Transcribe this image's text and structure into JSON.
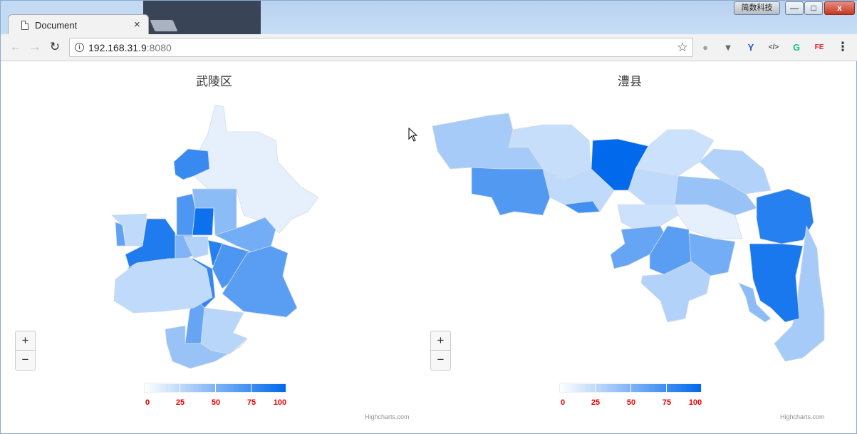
{
  "browser": {
    "tab_title": "Document",
    "tab_close": "×",
    "window_label": "简数科技",
    "win_min": "—",
    "win_max": "□",
    "win_close": "x",
    "url_host": "192.168.31.9",
    "url_port": ":8080",
    "info_icon": "i",
    "star_icon": "☆",
    "back_icon": "←",
    "forward_icon": "→",
    "reload_icon": "↻",
    "extensions": [
      {
        "name": "circle-ext-icon",
        "glyph": "●",
        "color": "#9aa39a"
      },
      {
        "name": "vue-ext-icon",
        "glyph": "▼",
        "color": "#666"
      },
      {
        "name": "y-ext-icon",
        "glyph": "Y",
        "color": "#2a55c8"
      },
      {
        "name": "code-ext-icon",
        "glyph": "</>",
        "color": "#555"
      },
      {
        "name": "grammarly-ext-icon",
        "glyph": "G",
        "color": "#15c39a"
      },
      {
        "name": "fe-ext-icon",
        "glyph": "FE",
        "color": "#d8262b"
      }
    ],
    "menu_icon": "⋮"
  },
  "colors": {
    "accent": "#0069ec",
    "legend_label": "#ee0000"
  },
  "charts": [
    {
      "title": "武陵区",
      "zoom_in": "+",
      "zoom_out": "−",
      "credits": "Highcharts.com",
      "legend_labels": [
        "0",
        "25",
        "50",
        "75",
        "100"
      ]
    },
    {
      "title": "澧县",
      "zoom_in": "+",
      "zoom_out": "−",
      "credits": "Highcharts.com",
      "legend_labels": [
        "0",
        "25",
        "50",
        "75",
        "100"
      ]
    }
  ],
  "chart_data": [
    {
      "type": "map",
      "title": "武陵区",
      "color_axis": {
        "min": 0,
        "max": 100,
        "min_color": "#ffffff",
        "max_color": "#0069ec"
      },
      "region_values": [
        10,
        78,
        45,
        95,
        70,
        88,
        62,
        25,
        50,
        85,
        30,
        55,
        70,
        65,
        80,
        60,
        28,
        85,
        25,
        40
      ]
    },
    {
      "type": "map",
      "title": "澧县",
      "color_axis": {
        "min": 0,
        "max": 100,
        "min_color": "#ffffff",
        "max_color": "#0069ec"
      },
      "region_values": [
        35,
        22,
        68,
        25,
        75,
        100,
        20,
        30,
        25,
        40,
        10,
        20,
        60,
        65,
        55,
        85,
        35,
        90,
        30,
        45
      ]
    }
  ]
}
